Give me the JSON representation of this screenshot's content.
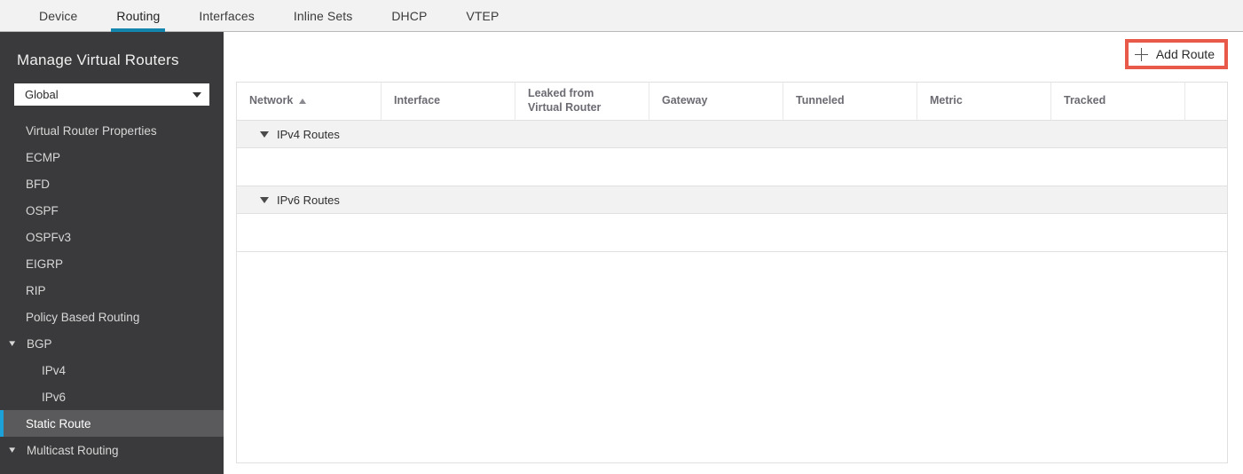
{
  "tabs": [
    {
      "label": "Device",
      "active": false
    },
    {
      "label": "Routing",
      "active": true
    },
    {
      "label": "Interfaces",
      "active": false
    },
    {
      "label": "Inline Sets",
      "active": false
    },
    {
      "label": "DHCP",
      "active": false
    },
    {
      "label": "VTEP",
      "active": false
    }
  ],
  "sidebar": {
    "title": "Manage Virtual Routers",
    "selector": {
      "value": "Global",
      "icon": "chevron-down-icon"
    },
    "items": [
      {
        "label": "Virtual Router Properties",
        "type": "leaf",
        "active": false
      },
      {
        "label": "ECMP",
        "type": "leaf",
        "active": false
      },
      {
        "label": "BFD",
        "type": "leaf",
        "active": false
      },
      {
        "label": "OSPF",
        "type": "leaf",
        "active": false
      },
      {
        "label": "OSPFv3",
        "type": "leaf",
        "active": false
      },
      {
        "label": "EIGRP",
        "type": "leaf",
        "active": false
      },
      {
        "label": "RIP",
        "type": "leaf",
        "active": false
      },
      {
        "label": "Policy Based Routing",
        "type": "leaf",
        "active": false
      },
      {
        "label": "BGP",
        "type": "group",
        "expanded": true,
        "active": false
      },
      {
        "label": "IPv4",
        "type": "child",
        "active": false
      },
      {
        "label": "IPv6",
        "type": "child",
        "active": false
      },
      {
        "label": "Static Route",
        "type": "leaf",
        "active": true
      },
      {
        "label": "Multicast Routing",
        "type": "group",
        "expanded": true,
        "active": false
      }
    ]
  },
  "toolbar": {
    "add_route_label": "Add Route",
    "add_route_icon": "plus-icon",
    "highlight_color": "#e8594a"
  },
  "table": {
    "columns": [
      {
        "label": "Network",
        "sort": "asc",
        "width": 163
      },
      {
        "label": "Interface",
        "sort": null,
        "width": 151
      },
      {
        "label": "Leaked from\nVirtual Router",
        "sort": null,
        "width": 151
      },
      {
        "label": "Gateway",
        "sort": null,
        "width": 151
      },
      {
        "label": "Tunneled",
        "sort": null,
        "width": 151
      },
      {
        "label": "Metric",
        "sort": null,
        "width": 151
      },
      {
        "label": "Tracked",
        "sort": null,
        "width": 151
      },
      {
        "label": "",
        "sort": null,
        "width": 0
      }
    ],
    "groups": [
      {
        "label": "IPv4 Routes",
        "expanded": true,
        "rows": []
      },
      {
        "label": "IPv6 Routes",
        "expanded": true,
        "rows": []
      }
    ]
  },
  "colors": {
    "accent_blue": "#1485ad",
    "sidebar_bg": "#3a3a3c",
    "active_item_bg": "#5a5a5c",
    "active_bar": "#1ba0d7",
    "annotation_red": "#e8594a"
  }
}
